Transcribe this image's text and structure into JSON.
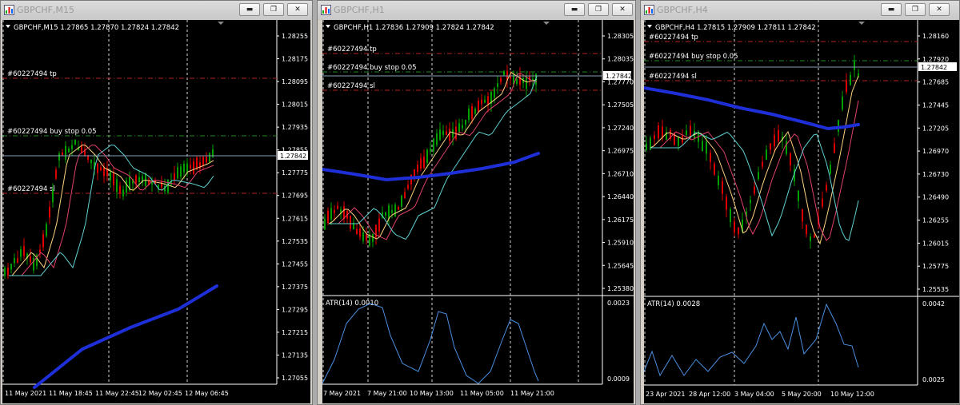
{
  "windows": [
    {
      "title": "GBPCHF,M15",
      "info": "GBPCHF,M15  1.27865 1.27870 1.27824 1.27842",
      "price_scale": [
        "1.28255",
        "1.28175",
        "1.28095",
        "1.28015",
        "1.27935",
        "1.27855",
        "1.27775",
        "1.27695",
        "1.27615",
        "1.27535",
        "1.27455",
        "1.27375",
        "1.27295",
        "1.27215",
        "1.27135",
        "1.27055"
      ],
      "time_labels": [
        "11 May 2021",
        "11 May 18:45",
        "11 May 22:45",
        "12 May 02:45",
        "12 May 06:45"
      ],
      "current_price": "1.27842",
      "order_lines": [
        {
          "label": "#60227494 tp",
          "type": "tp",
          "color": "#b22222"
        },
        {
          "label": "#60227494 buy stop 0.05",
          "type": "entry",
          "color": "#228b22"
        },
        {
          "label": "#60227494 sl",
          "type": "sl",
          "color": "#b22222"
        }
      ]
    },
    {
      "title": "GBPCHF,H1",
      "info": "GBPCHF,H1  1.27836 1.27909 1.27824 1.27842",
      "price_scale": [
        "1.28305",
        "1.28035",
        "1.27770",
        "1.27505",
        "1.27240",
        "1.26975",
        "1.26710",
        "1.26440",
        "1.26175",
        "1.25910",
        "1.25645",
        "1.25380"
      ],
      "time_labels": [
        "7 May 2021",
        "7 May 21:00",
        "10 May 13:00",
        "11 May 05:00",
        "11 May 21:00"
      ],
      "current_price": "1.27842",
      "order_lines": [
        {
          "label": "#60227494 tp",
          "type": "tp",
          "color": "#b22222"
        },
        {
          "label": "#60227494 buy stop 0.05",
          "type": "entry",
          "color": "#228b22"
        },
        {
          "label": "#60227494 sl",
          "type": "sl",
          "color": "#b22222"
        }
      ],
      "indicator": {
        "label": "ATR(14) 0.0010",
        "scale_max": "0.0023",
        "scale_min": "0.0009"
      }
    },
    {
      "title": "GBPCHF,H4",
      "info": "GBPCHF,H4  1.27815 1.27909 1.27811 1.27842",
      "price_scale": [
        "1.28160",
        "1.27920",
        "1.27685",
        "1.27445",
        "1.27205",
        "1.26970",
        "1.26730",
        "1.26490",
        "1.26255",
        "1.26015",
        "1.25775",
        "1.25535"
      ],
      "time_labels": [
        "23 Apr 2021",
        "28 Apr 12:00",
        "3 May 04:00",
        "5 May 20:00",
        "10 May 12:00"
      ],
      "current_price": "1.27842",
      "order_lines": [
        {
          "label": "#60227494 tp",
          "type": "tp",
          "color": "#b22222"
        },
        {
          "label": "#60227494 buy stop 0.05",
          "type": "entry",
          "color": "#228b22"
        },
        {
          "label": "#60227494 sl",
          "type": "sl",
          "color": "#b22222"
        }
      ],
      "indicator": {
        "label": "ATR(14) 0.0028",
        "scale_max": "0.0042",
        "scale_min": "0.0025"
      }
    }
  ],
  "colors": {
    "bull": "#00a000",
    "bear": "#dd0000",
    "ma_fast": "#ffd27f",
    "ma_mid": "#e0406a",
    "ma_slow": "#5fd0d0",
    "ma_long": "#1f2fd8",
    "atr": "#4a8fe0",
    "grid": "#d8d8d8",
    "price_line": "#8aa0b8"
  },
  "icons": {
    "window": "chart-icon",
    "minimize": "minimize-icon",
    "restore": "restore-icon",
    "close": "close-icon"
  }
}
